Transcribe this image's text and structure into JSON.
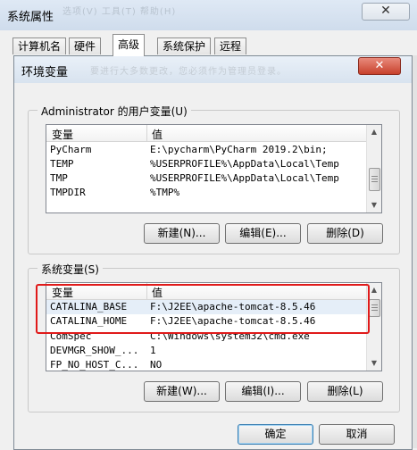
{
  "outer_window": {
    "title": "系统属性",
    "close_glyph": "✕",
    "blurred_title_text": "选项(V)   工具(T)   帮助(H)"
  },
  "tabs": [
    {
      "label": "计算机名",
      "active": false
    },
    {
      "label": "硬件",
      "active": false
    },
    {
      "label": "高级",
      "active": true
    },
    {
      "label": "系统保护",
      "active": false
    },
    {
      "label": "远程",
      "active": false
    }
  ],
  "env_dialog": {
    "title": "环境变量",
    "blurred_text": "要进行大多数更改，您必须作为管理员登录。",
    "close_glyph": "✕",
    "user_vars": {
      "group_label": "Administrator 的用户变量(U)",
      "columns": [
        "变量",
        "值"
      ],
      "rows": [
        {
          "name": "PyCharm",
          "value": "E:\\pycharm\\PyCharm 2019.2\\bin;"
        },
        {
          "name": "TEMP",
          "value": "%USERPROFILE%\\AppData\\Local\\Temp"
        },
        {
          "name": "TMP",
          "value": "%USERPROFILE%\\AppData\\Local\\Temp"
        },
        {
          "name": "TMPDIR",
          "value": "%TMP%"
        }
      ],
      "buttons": {
        "new": "新建(N)...",
        "edit": "编辑(E)...",
        "delete": "删除(D)"
      }
    },
    "system_vars": {
      "group_label": "系统变量(S)",
      "columns": [
        "变量",
        "值"
      ],
      "rows": [
        {
          "name": "CATALINA_BASE",
          "value": "F:\\J2EE\\apache-tomcat-8.5.46"
        },
        {
          "name": "CATALINA_HOME",
          "value": "F:\\J2EE\\apache-tomcat-8.5.46"
        },
        {
          "name": "ComSpec",
          "value": "C:\\Windows\\system32\\cmd.exe"
        },
        {
          "name": "DEVMGR_SHOW_...",
          "value": "1"
        },
        {
          "name": "FP_NO_HOST_C...",
          "value": "NO"
        }
      ],
      "buttons": {
        "new": "新建(W)...",
        "edit": "编辑(I)...",
        "delete": "删除(L)"
      }
    },
    "footer": {
      "ok": "确定",
      "cancel": "取消"
    }
  },
  "colors": {
    "highlight_outline": "#e01a1a",
    "close_button": "#c7412c"
  }
}
